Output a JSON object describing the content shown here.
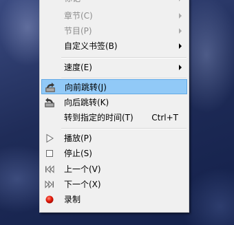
{
  "context_menu": {
    "top_partial_label": "标记",
    "items": [
      {
        "label": "章节(C)"
      },
      {
        "label": "节目(P)"
      },
      {
        "label": "自定义书签(B)"
      },
      {
        "label": "速度(E)"
      },
      {
        "label": "向前跳转(J)",
        "icon": "jump-forward-icon"
      },
      {
        "label": "向后跳转(K)",
        "icon": "jump-back-icon"
      },
      {
        "label": "转到指定的时间(T)",
        "shortcut": "Ctrl+T"
      },
      {
        "label": "播放(P)",
        "icon": "play-icon"
      },
      {
        "label": "停止(S)",
        "icon": "stop-icon"
      },
      {
        "label": "上一个(V)",
        "icon": "previous-icon"
      },
      {
        "label": "下一个(X)",
        "icon": "next-icon"
      },
      {
        "label": "录制",
        "icon": "record-icon"
      }
    ]
  }
}
